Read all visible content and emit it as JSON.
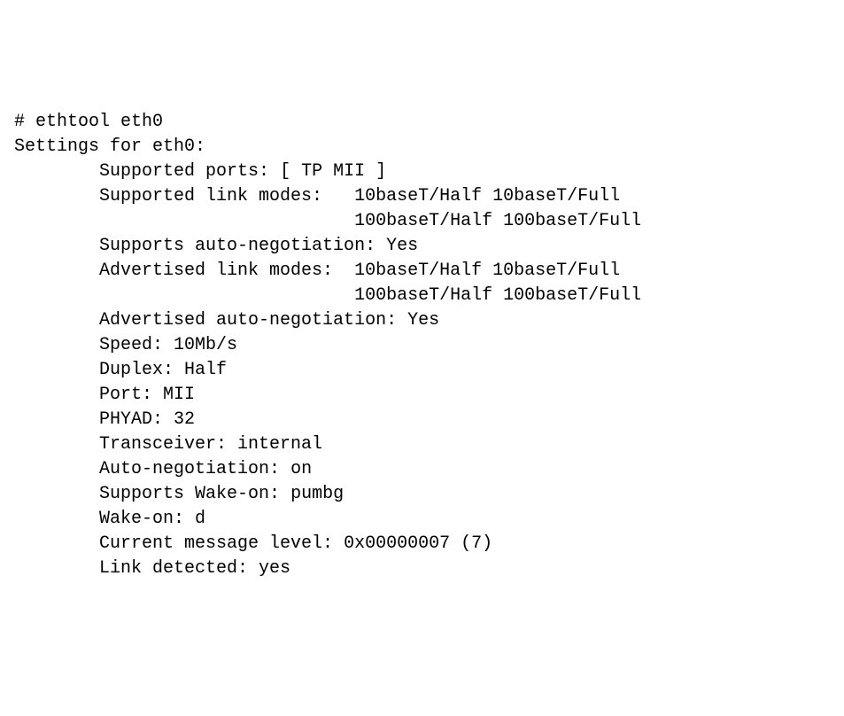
{
  "terminal": {
    "prompt": "# ",
    "command": "ethtool eth0",
    "header": "Settings for eth0:",
    "fields": {
      "supported_ports_label": "Supported ports: ",
      "supported_ports_value": "[ TP MII ]",
      "supported_link_modes_label": "Supported link modes:   ",
      "supported_link_modes_line1": "10baseT/Half 10baseT/Full",
      "supported_link_modes_line2": "100baseT/Half 100baseT/Full",
      "supports_autoneg_label": "Supports auto-negotiation: ",
      "supports_autoneg_value": "Yes",
      "advertised_link_modes_label": "Advertised link modes:  ",
      "advertised_link_modes_line1": "10baseT/Half 10baseT/Full",
      "advertised_link_modes_line2": "100baseT/Half 100baseT/Full",
      "advertised_autoneg_label": "Advertised auto-negotiation: ",
      "advertised_autoneg_value": "Yes",
      "speed_label": "Speed: ",
      "speed_value": "10Mb/s",
      "duplex_label": "Duplex: ",
      "duplex_value": "Half",
      "port_label": "Port: ",
      "port_value": "MII",
      "phyad_label": "PHYAD: ",
      "phyad_value": "32",
      "transceiver_label": "Transceiver: ",
      "transceiver_value": "internal",
      "autoneg_label": "Auto-negotiation: ",
      "autoneg_value": "on",
      "supports_wol_label": "Supports Wake-on: ",
      "supports_wol_value": "pumbg",
      "wol_label": "Wake-on: ",
      "wol_value": "d",
      "msg_level_label": "Current message level: ",
      "msg_level_value": "0x00000007 (7)",
      "link_detected_label": "Link detected: ",
      "link_detected_value": "yes"
    }
  }
}
